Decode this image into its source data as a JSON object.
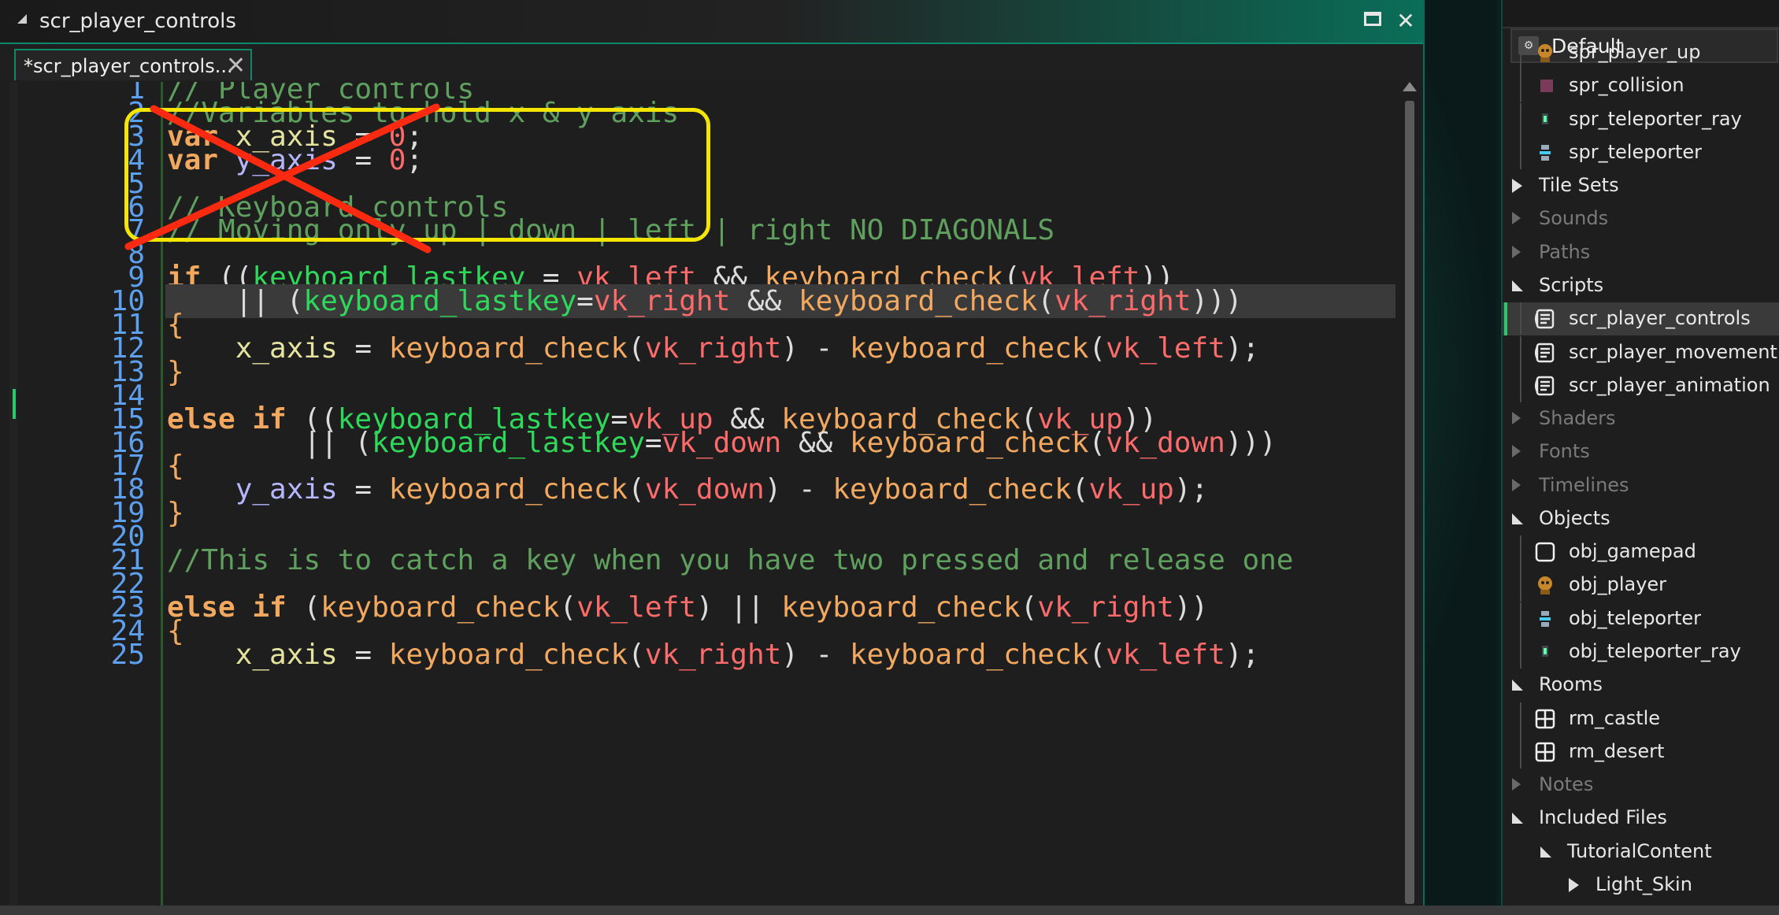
{
  "window": {
    "title": "scr_player_controls",
    "maximize_glyph": "",
    "close_glyph": "✕"
  },
  "tab": {
    "label": "*scr_player_controls...",
    "close_glyph": "✕"
  },
  "editor": {
    "active_line": 10,
    "lines": [
      {
        "n": "1",
        "tokens": [
          [
            "com",
            "// Player controls"
          ]
        ]
      },
      {
        "n": "2",
        "tokens": [
          [
            "com",
            "//Variables to hold x & y axis"
          ]
        ]
      },
      {
        "n": "3",
        "tokens": [
          [
            "kw",
            "var"
          ],
          [
            "op",
            " "
          ],
          [
            "id",
            "x_axis"
          ],
          [
            "op",
            " = "
          ],
          [
            "num",
            "0"
          ],
          [
            "op",
            ";"
          ]
        ]
      },
      {
        "n": "4",
        "tokens": [
          [
            "kw",
            "var"
          ],
          [
            "op",
            " "
          ],
          [
            "var",
            "y_axis"
          ],
          [
            "op",
            " = "
          ],
          [
            "num",
            "0"
          ],
          [
            "op",
            ";"
          ]
        ]
      },
      {
        "n": "5",
        "tokens": []
      },
      {
        "n": "6",
        "tokens": [
          [
            "com",
            "// Keyboard controls"
          ]
        ]
      },
      {
        "n": "7",
        "tokens": [
          [
            "com",
            "// Moving only up | down | left | right NO DIAGONALS"
          ]
        ]
      },
      {
        "n": "8",
        "tokens": []
      },
      {
        "n": "9",
        "tokens": [
          [
            "kw",
            "if"
          ],
          [
            "op",
            " (("
          ],
          [
            "kfn",
            "keyboard_lastkey"
          ],
          [
            "op",
            " = "
          ],
          [
            "vk",
            "vk_left"
          ],
          [
            "op",
            " && "
          ],
          [
            "fn",
            "keyboard_check"
          ],
          [
            "op",
            "("
          ],
          [
            "vk",
            "vk_left"
          ],
          [
            "op",
            "))"
          ]
        ]
      },
      {
        "n": "10",
        "tokens": [
          [
            "op",
            "    || ("
          ],
          [
            "kfn",
            "keyboard_lastkey"
          ],
          [
            "op",
            "="
          ],
          [
            "vk",
            "vk_right"
          ],
          [
            "op",
            " && "
          ],
          [
            "fn",
            "keyboard_check"
          ],
          [
            "op",
            "("
          ],
          [
            "vk",
            "vk_right"
          ],
          [
            "op",
            ")))"
          ]
        ]
      },
      {
        "n": "11",
        "tokens": [
          [
            "br",
            "{"
          ]
        ]
      },
      {
        "n": "12",
        "tokens": [
          [
            "op",
            "    "
          ],
          [
            "id",
            "x_axis"
          ],
          [
            "op",
            " = "
          ],
          [
            "fn",
            "keyboard_check"
          ],
          [
            "op",
            "("
          ],
          [
            "vk",
            "vk_right"
          ],
          [
            "op",
            ") - "
          ],
          [
            "fn",
            "keyboard_check"
          ],
          [
            "op",
            "("
          ],
          [
            "vk",
            "vk_left"
          ],
          [
            "op",
            ");"
          ]
        ]
      },
      {
        "n": "13",
        "tokens": [
          [
            "br",
            "}"
          ]
        ]
      },
      {
        "n": "14",
        "tokens": []
      },
      {
        "n": "15",
        "tokens": [
          [
            "kw",
            "else if"
          ],
          [
            "op",
            " (("
          ],
          [
            "kfn",
            "keyboard_lastkey"
          ],
          [
            "op",
            "="
          ],
          [
            "vk",
            "vk_up"
          ],
          [
            "op",
            " && "
          ],
          [
            "fn",
            "keyboard_check"
          ],
          [
            "op",
            "("
          ],
          [
            "vk",
            "vk_up"
          ],
          [
            "op",
            "))"
          ]
        ]
      },
      {
        "n": "16",
        "tokens": [
          [
            "op",
            "        || ("
          ],
          [
            "kfn",
            "keyboard_lastkey"
          ],
          [
            "op",
            "="
          ],
          [
            "vk",
            "vk_down"
          ],
          [
            "op",
            " && "
          ],
          [
            "fn",
            "keyboard_check"
          ],
          [
            "op",
            "("
          ],
          [
            "vk",
            "vk_down"
          ],
          [
            "op",
            ")))"
          ]
        ]
      },
      {
        "n": "17",
        "tokens": [
          [
            "br",
            "{"
          ]
        ]
      },
      {
        "n": "18",
        "tokens": [
          [
            "op",
            "    "
          ],
          [
            "var",
            "y_axis"
          ],
          [
            "op",
            " = "
          ],
          [
            "fn",
            "keyboard_check"
          ],
          [
            "op",
            "("
          ],
          [
            "vk",
            "vk_down"
          ],
          [
            "op",
            ") - "
          ],
          [
            "fn",
            "keyboard_check"
          ],
          [
            "op",
            "("
          ],
          [
            "vk",
            "vk_up"
          ],
          [
            "op",
            ");"
          ]
        ]
      },
      {
        "n": "19",
        "tokens": [
          [
            "br",
            "}"
          ]
        ]
      },
      {
        "n": "20",
        "tokens": []
      },
      {
        "n": "21",
        "tokens": [
          [
            "com",
            "//This is to catch a key when you have two pressed and release one"
          ]
        ]
      },
      {
        "n": "22",
        "tokens": []
      },
      {
        "n": "23",
        "tokens": [
          [
            "kw",
            "else if"
          ],
          [
            "op",
            " ("
          ],
          [
            "fn",
            "keyboard_check"
          ],
          [
            "op",
            "("
          ],
          [
            "vk",
            "vk_left"
          ],
          [
            "op",
            ") || "
          ],
          [
            "fn",
            "keyboard_check"
          ],
          [
            "op",
            "("
          ],
          [
            "vk",
            "vk_right"
          ],
          [
            "op",
            "))"
          ]
        ]
      },
      {
        "n": "24",
        "tokens": [
          [
            "br",
            "{"
          ]
        ]
      },
      {
        "n": "25",
        "tokens": [
          [
            "op",
            "    "
          ],
          [
            "id",
            "x_axis"
          ],
          [
            "op",
            " = "
          ],
          [
            "fn",
            "keyboard_check"
          ],
          [
            "op",
            "("
          ],
          [
            "vk",
            "vk_right"
          ],
          [
            "op",
            ") - "
          ],
          [
            "fn",
            "keyboard_check"
          ],
          [
            "op",
            "("
          ],
          [
            "vk",
            "vk_left"
          ],
          [
            "op",
            ");"
          ]
        ]
      }
    ]
  },
  "annotation": {
    "box_color": "#f4e600",
    "cross_color": "#ff2a10"
  },
  "resources": {
    "config": "Default",
    "items": [
      {
        "label": "spr_player_up",
        "kind": "leaf",
        "icon": "player-sprite-icon",
        "dim": false
      },
      {
        "label": "spr_collision",
        "kind": "leaf",
        "icon": "collision-sprite-icon",
        "dim": false
      },
      {
        "label": "spr_teleporter_ray",
        "kind": "leaf",
        "icon": "teleporter-ray-icon",
        "dim": false
      },
      {
        "label": "spr_teleporter",
        "kind": "leaf",
        "icon": "teleporter-icon",
        "dim": false
      },
      {
        "label": "Tile Sets",
        "kind": "group-collapsed",
        "dim": false
      },
      {
        "label": "Sounds",
        "kind": "group-collapsed",
        "dim": true
      },
      {
        "label": "Paths",
        "kind": "group-collapsed",
        "dim": true
      },
      {
        "label": "Scripts",
        "kind": "group-open",
        "dim": false
      },
      {
        "label": "scr_player_controls",
        "kind": "leaf",
        "icon": "script-icon",
        "dim": false,
        "selected": true
      },
      {
        "label": "scr_player_movement",
        "kind": "leaf",
        "icon": "script-icon",
        "dim": false
      },
      {
        "label": "scr_player_animation",
        "kind": "leaf",
        "icon": "script-icon",
        "dim": false
      },
      {
        "label": "Shaders",
        "kind": "group-collapsed",
        "dim": true
      },
      {
        "label": "Fonts",
        "kind": "group-collapsed",
        "dim": true
      },
      {
        "label": "Timelines",
        "kind": "group-collapsed",
        "dim": true
      },
      {
        "label": "Objects",
        "kind": "group-open",
        "dim": false
      },
      {
        "label": "obj_gamepad",
        "kind": "leaf",
        "icon": "object-empty-icon",
        "dim": false
      },
      {
        "label": "obj_player",
        "kind": "leaf",
        "icon": "player-sprite-icon",
        "dim": false
      },
      {
        "label": "obj_teleporter",
        "kind": "leaf",
        "icon": "teleporter-icon",
        "dim": false
      },
      {
        "label": "obj_teleporter_ray",
        "kind": "leaf",
        "icon": "teleporter-ray-icon",
        "dim": false
      },
      {
        "label": "Rooms",
        "kind": "group-open",
        "dim": false
      },
      {
        "label": "rm_castle",
        "kind": "leaf",
        "icon": "room-icon",
        "dim": false
      },
      {
        "label": "rm_desert",
        "kind": "leaf",
        "icon": "room-icon",
        "dim": false
      },
      {
        "label": "Notes",
        "kind": "group-collapsed",
        "dim": true
      },
      {
        "label": "Included Files",
        "kind": "group-open",
        "dim": false
      },
      {
        "label": "TutorialContent",
        "kind": "subgroup-open",
        "dim": false
      },
      {
        "label": "Light_Skin",
        "kind": "subgroup-collapsed",
        "dim": false
      }
    ]
  }
}
